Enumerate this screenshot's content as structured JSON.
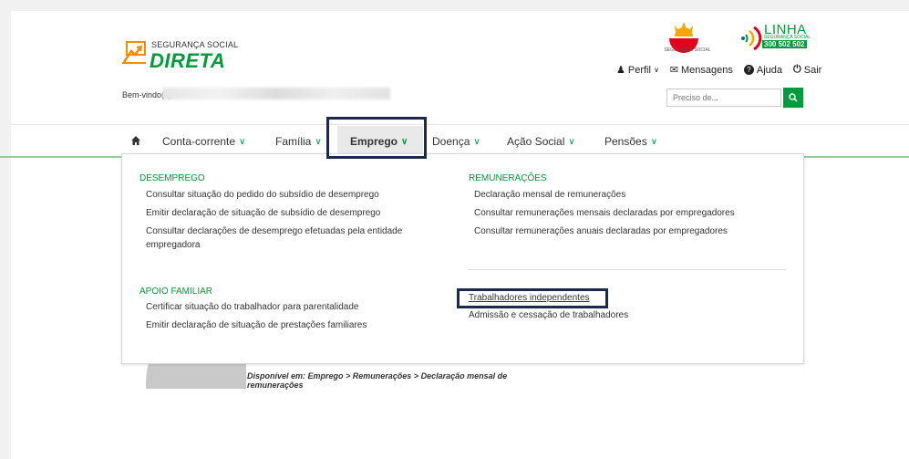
{
  "header": {
    "logo_small": "SEGURANÇA SOCIAL",
    "logo_big": "DIRETA",
    "welcome": "Bem-vindo(s),",
    "ss_logo_text": "SEGURANÇA SOCIAL",
    "linha_title": "LINHA",
    "linha_sub": "SEGURANÇA SOCIAL",
    "linha_number": "300 502 502",
    "toplinks": {
      "perfil": "Perfil",
      "mensagens": "Mensagens",
      "ajuda": "Ajuda",
      "sair": "Sair"
    },
    "search_placeholder": "Preciso de..."
  },
  "nav": {
    "items": [
      "Conta-corrente",
      "Família",
      "Emprego",
      "Doença",
      "Ação Social",
      "Pensões"
    ],
    "active": "Emprego"
  },
  "dropdown": {
    "desemprego": {
      "title": "DESEMPREGO",
      "links": [
        "Consultar situação do pedido do subsídio de desemprego",
        "Emitir declaração de situação de subsídio de desemprego",
        "Consultar declarações de desemprego efetuadas pela entidade",
        "empregadora"
      ]
    },
    "apoio": {
      "title": "APOIO FAMILIAR",
      "links": [
        "Certificar situação do trabalhador para parentalidade",
        "Emitir declaração de situação de prestações familiares"
      ]
    },
    "remuneracoes": {
      "title": "REMUNERAÇÕES",
      "links": [
        "Declaração mensal de remunerações",
        "Consultar remunerações mensais declaradas por empregadores",
        "Consultar remunerações anuais declaradas por empregadores"
      ]
    },
    "outros": {
      "links": [
        "Trabalhadores independentes",
        "Admissão e cessação de trabalhadores"
      ]
    }
  },
  "breadcrumb": {
    "line1": "Disponível em: Emprego > Remunerações > Declaração mensal de",
    "line2": "remunerações"
  },
  "colors": {
    "brand_green": "#009b3a",
    "highlight_border": "#1a2a4a",
    "active_tab_bg": "#e9e9e9"
  }
}
